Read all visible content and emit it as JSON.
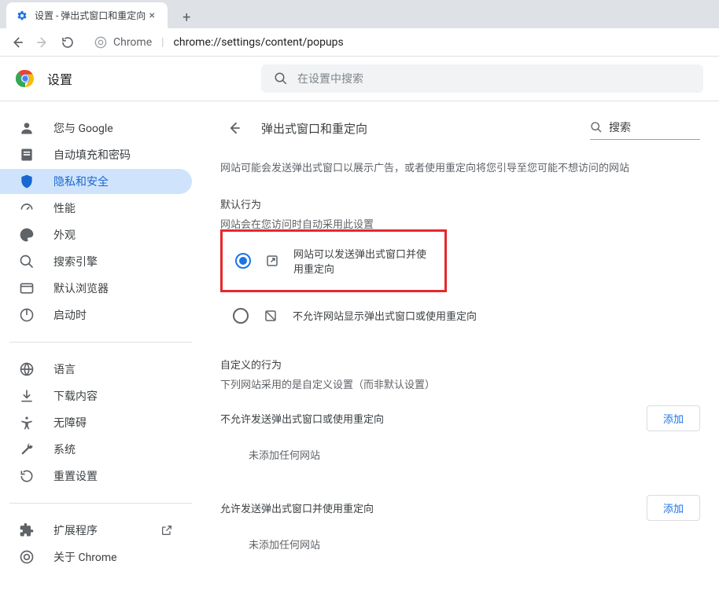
{
  "tab": {
    "title": "设置 - 弹出式窗口和重定向"
  },
  "omnibox": {
    "prefix": "Chrome",
    "url": "chrome://settings/content/popups"
  },
  "header": {
    "title": "设置",
    "search_placeholder": "在设置中搜索"
  },
  "sidebar": {
    "items": [
      {
        "label": "您与 Google",
        "icon": "person-icon",
        "active": false
      },
      {
        "label": "自动填充和密码",
        "icon": "autofill-icon",
        "active": false
      },
      {
        "label": "隐私和安全",
        "icon": "shield-icon",
        "active": true
      },
      {
        "label": "性能",
        "icon": "speedometer-icon",
        "active": false
      },
      {
        "label": "外观",
        "icon": "palette-icon",
        "active": false
      },
      {
        "label": "搜索引擎",
        "icon": "search-icon",
        "active": false
      },
      {
        "label": "默认浏览器",
        "icon": "browser-icon",
        "active": false
      },
      {
        "label": "启动时",
        "icon": "power-icon",
        "active": false
      }
    ],
    "items2": [
      {
        "label": "语言",
        "icon": "globe-icon"
      },
      {
        "label": "下载内容",
        "icon": "download-icon"
      },
      {
        "label": "无障碍",
        "icon": "accessibility-icon"
      },
      {
        "label": "系统",
        "icon": "wrench-icon"
      },
      {
        "label": "重置设置",
        "icon": "reset-icon"
      }
    ],
    "items3": [
      {
        "label": "扩展程序",
        "icon": "puzzle-icon",
        "external": true
      },
      {
        "label": "关于 Chrome",
        "icon": "chrome-icon"
      }
    ]
  },
  "panel": {
    "title": "弹出式窗口和重定向",
    "search_label": "搜索",
    "description": "网站可能会发送弹出式窗口以展示广告，或者使用重定向将您引导至您可能不想访问的网站",
    "default_heading": "默认行为",
    "default_sub": "网站会在您访问时自动采用此设置",
    "option_allow": "网站可以发送弹出式窗口并使用重定向",
    "option_block": "不允许网站显示弹出式窗口或使用重定向",
    "custom_heading": "自定义的行为",
    "custom_sub": "下列网站采用的是自定义设置（而非默认设置）",
    "block_section": "不允许发送弹出式窗口或使用重定向",
    "allow_section": "允许发送弹出式窗口并使用重定向",
    "add_label": "添加",
    "empty_text": "未添加任何网站"
  }
}
